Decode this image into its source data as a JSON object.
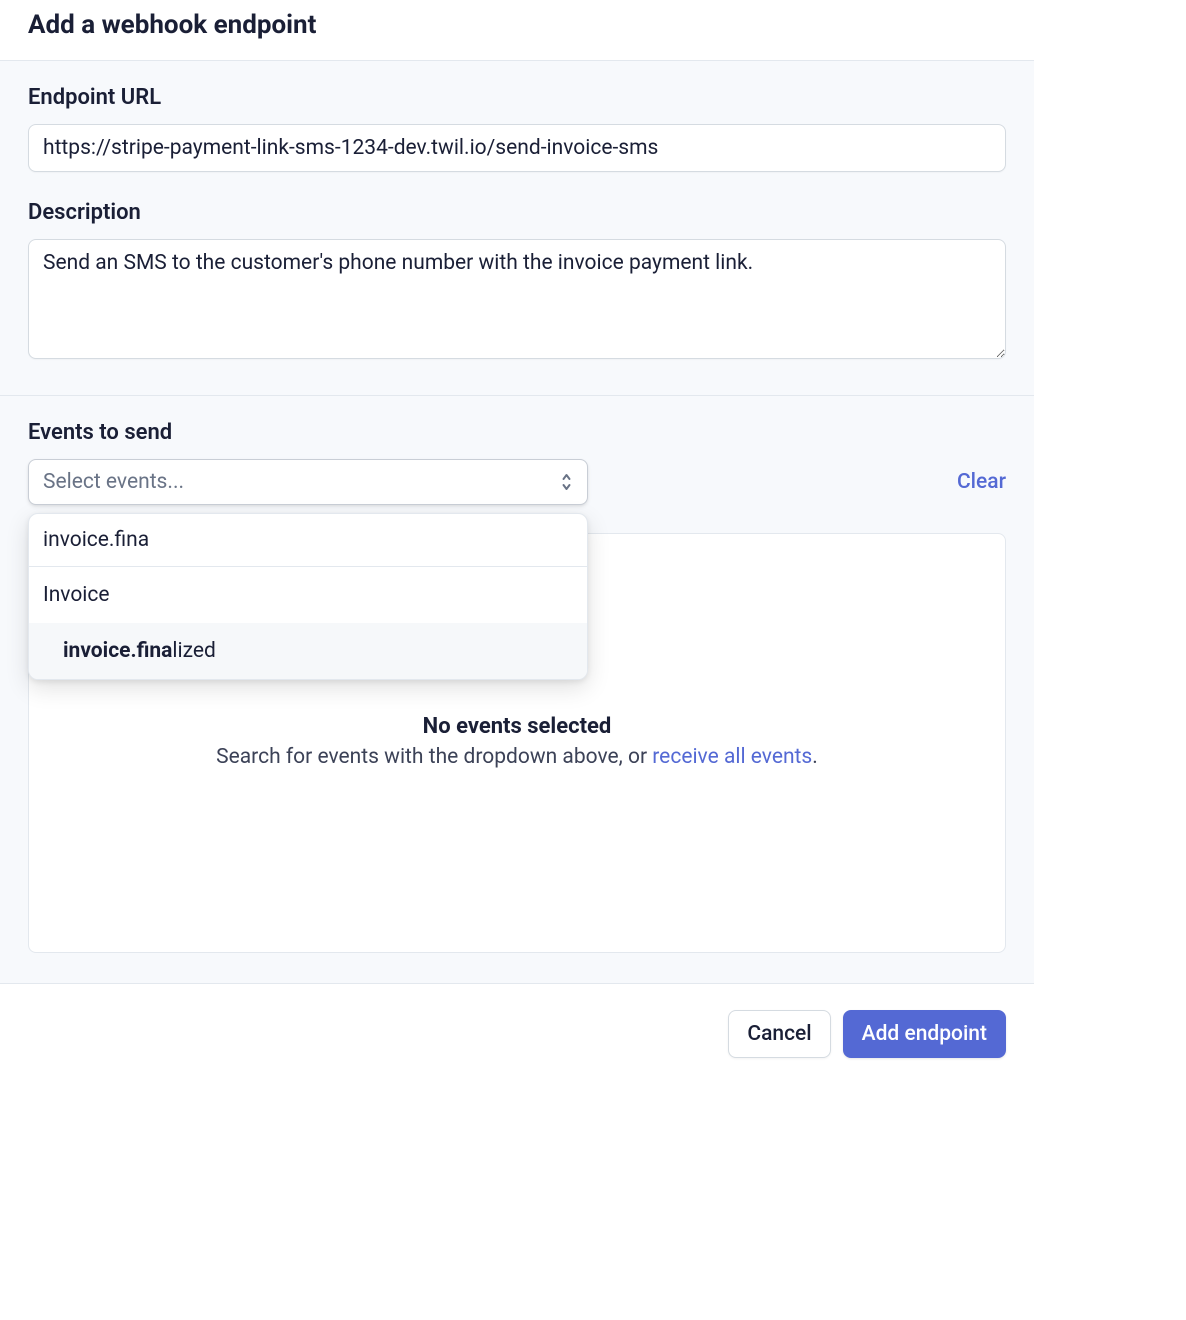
{
  "page_title": "Add a webhook endpoint",
  "endpoint_url": {
    "label": "Endpoint URL",
    "value": "https://stripe-payment-link-sms-1234-dev.twil.io/send-invoice-sms"
  },
  "description": {
    "label": "Description",
    "value": "Send an SMS to the customer's phone number with the invoice payment link."
  },
  "events": {
    "label": "Events to send",
    "select_placeholder": "Select events...",
    "clear_label": "Clear",
    "search_query": "invoice.fina",
    "group_label": "Invoice",
    "option_match": "invoice.fina",
    "option_rest": "lized",
    "empty_title": "No events selected",
    "empty_sub_prefix": "Search for events with the dropdown above, or ",
    "empty_sub_link": "receive all events",
    "empty_sub_suffix": "."
  },
  "footer": {
    "cancel": "Cancel",
    "submit": "Add endpoint"
  }
}
